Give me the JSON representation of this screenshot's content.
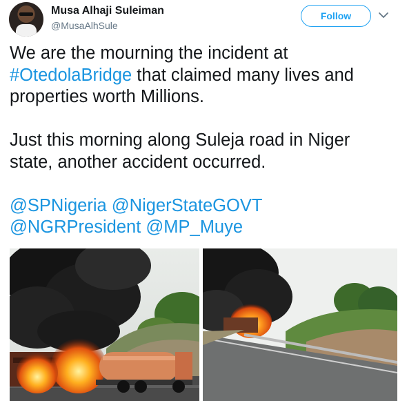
{
  "user": {
    "display_name": "Musa Alhaji Suleiman",
    "handle": "@MusaAlhSule"
  },
  "header": {
    "follow_label": "Follow",
    "menu_icon": "chevron-down-icon"
  },
  "tweet": {
    "line1_prefix": "We are the mourning the incident at",
    "hashtag": "#OtedolaBridge",
    "line1_suffix": " that claimed many lives and properties worth Millions.",
    "paragraph2": "Just this morning along Suleja road in Niger state, another accident occurred.",
    "mentions": [
      "@SPNigeria",
      "@NigerStateGOVT",
      "@NGRPresident",
      "@MP_Muye"
    ]
  },
  "colors": {
    "accent": "#1da1f2",
    "link": "#1b95e0",
    "text": "#14171a",
    "secondary": "#657786"
  }
}
